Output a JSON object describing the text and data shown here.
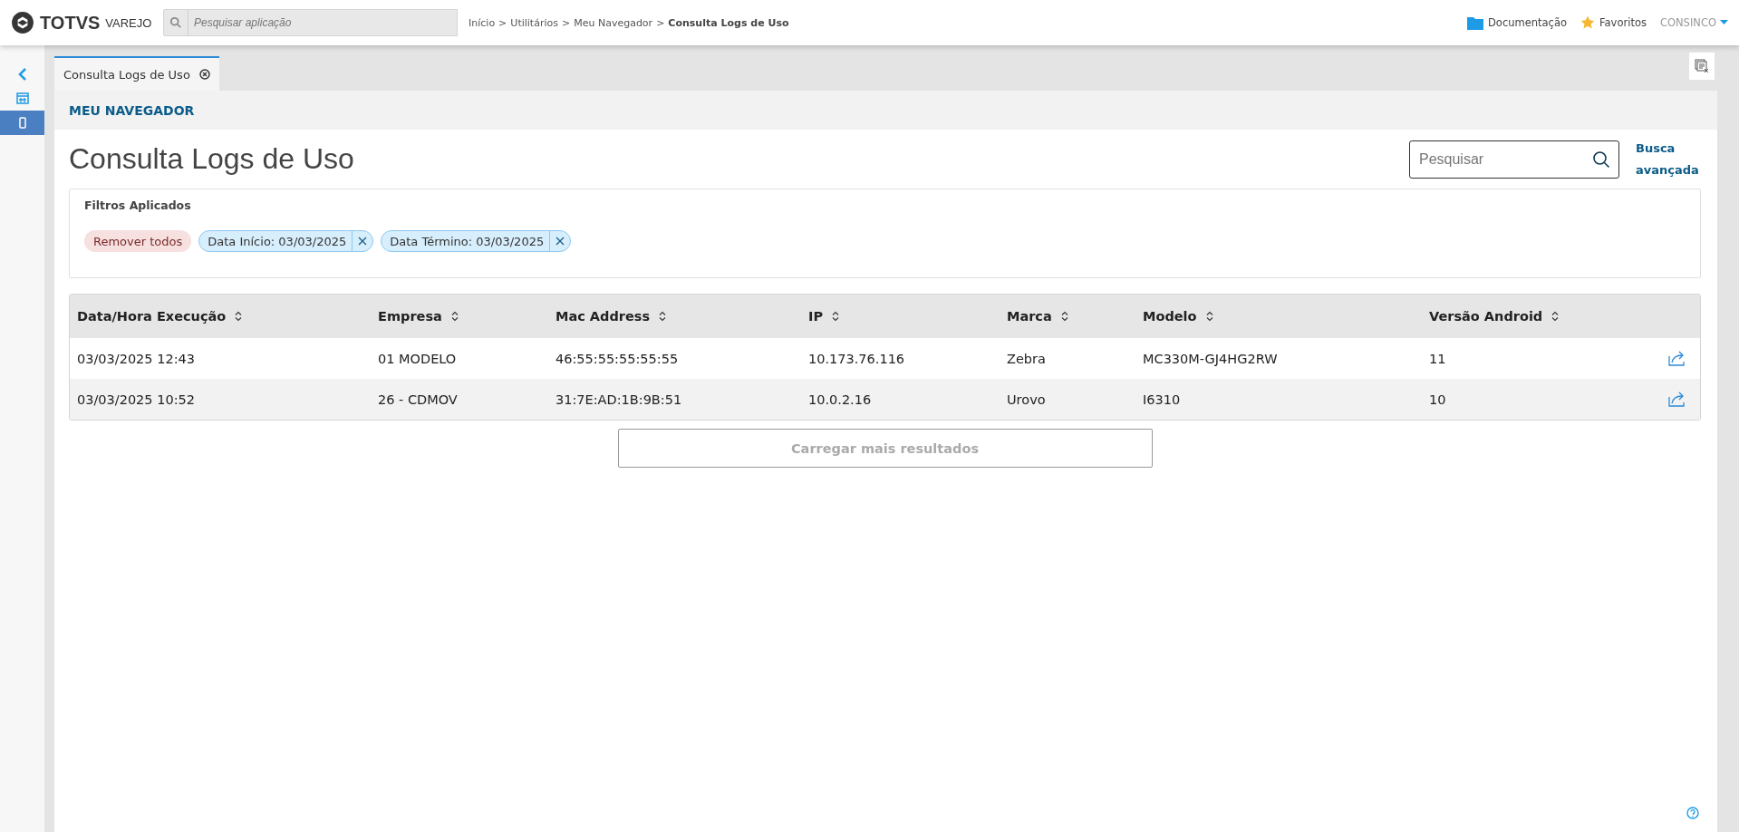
{
  "header": {
    "logo": "TOTVS",
    "product": "VAREJO",
    "search": {
      "placeholder": "Pesquisar aplicação"
    },
    "breadcrumb_separator": ">",
    "breadcrumb": [
      "Início",
      "Utilitários",
      "Meu Navegador",
      "Consulta Logs de Uso"
    ],
    "links": [
      "Documentação",
      "Favoritos"
    ],
    "user": "CONSINCO"
  },
  "sidebar": {
    "items": [
      {
        "kind": "calendar",
        "selected": false
      },
      {
        "kind": "phone",
        "selected": true
      }
    ]
  },
  "tabs": [
    {
      "label": "Consulta Logs de Uso",
      "selected": true
    }
  ],
  "section": "MEU NAVEGADOR",
  "page_title": "Consulta Logs de Uso",
  "search": {
    "placeholder": "Pesquisar"
  },
  "advanced_search": "Busca avançada",
  "filters": {
    "title": "Filtros Aplicados",
    "remove_all": "Remover todos",
    "chips": [
      "Data Início: 03/03/2025",
      "Data Término: 03/03/2025"
    ]
  },
  "table": {
    "columns": [
      "Data/Hora Execução",
      "Empresa",
      "Mac Address",
      "IP",
      "Marca",
      "Modelo",
      "Versão Android"
    ],
    "rows": [
      {
        "cells": [
          "03/03/2025 12:43",
          "01 MODELO",
          "46:55:55:55:55:55",
          "10.173.76.116",
          "Zebra",
          "MC330M-GJ4HG2RW",
          "11"
        ]
      },
      {
        "cells": [
          "03/03/2025 10:52",
          "26 - CDMOV",
          "31:7E:AD:1B:9B:51",
          "10.0.2.16",
          "Urovo",
          "I6310",
          "10"
        ]
      }
    ]
  },
  "load_more": "Carregar mais resultados"
}
